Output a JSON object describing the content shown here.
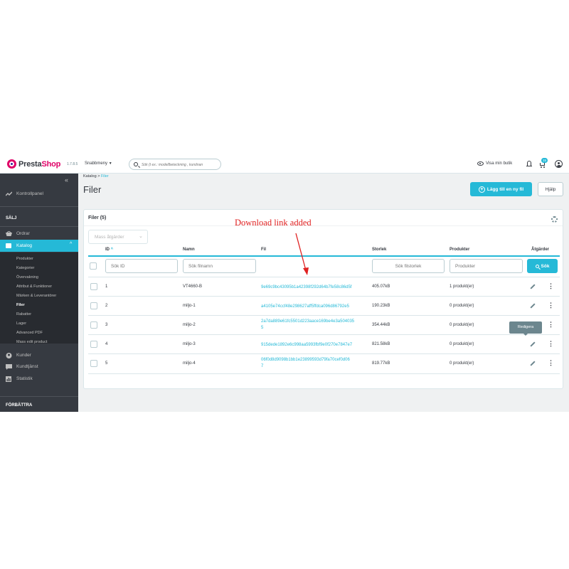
{
  "header": {
    "brand_prefix": "Presta",
    "brand_suffix": "Shop",
    "version": "1.7.8.5",
    "quick_menu_label": "Snabbmeny",
    "search_placeholder": "Sök (t ex.: modellbeteckning , kundnan",
    "view_shop_label": "Visa min butik",
    "cart_badge": "15"
  },
  "sidebar": {
    "dashboard": "Kontrollpanel",
    "section_sell": "SÄLJ",
    "orders": "Ordrar",
    "catalog": "Katalog",
    "catalog_items": [
      "Produkter",
      "Kategorier",
      "Övervakning",
      "Attribut & Funktioner",
      "Märken & Leverantörer",
      "Filer",
      "Rabatter",
      "Lager",
      "Advanced PDF",
      "Mass edit product"
    ],
    "customers": "Kunder",
    "customer_service": "Kundtjänst",
    "stats": "Statistik",
    "section_improve": "FÖRBÄTTRA"
  },
  "breadcrumb": {
    "parent": "Katalog",
    "separator": ">",
    "current": "Filer"
  },
  "page": {
    "title": "Filer",
    "add_button": "Lägg till en ny fil",
    "help_button": "Hjälp"
  },
  "card": {
    "title": "Filer (5)",
    "bulk_actions": "Mass åtgärder",
    "columns": {
      "id": "ID",
      "name": "Namn",
      "file": "Fil",
      "size": "Storlek",
      "products": "Produkter",
      "actions": "Åtgärder"
    },
    "filters": {
      "id": "Sök ID",
      "name": "Sök filnamn",
      "size": "Sök filstorlek",
      "products": "Produkter",
      "search_button": "Sök"
    },
    "rows": [
      {
        "id": "1",
        "name": "VT4660-B",
        "file_line1": "9e69c9bc43095b1a42398f292d64b7fe58c86d5f",
        "file_line2": "",
        "size": "405.07kB",
        "products": "1 produkt(er)"
      },
      {
        "id": "2",
        "name": "miljo-1",
        "file_line1": "a4105e74ccf48e298627aff5ffdca096d86792e5",
        "file_line2": "",
        "size": "190.23kB",
        "products": "0 produkt(er)"
      },
      {
        "id": "3",
        "name": "miljo-2",
        "file_line1": "2a7da889e61fc5501d223aace169be4e3a504035",
        "file_line2": "5",
        "size": "354.44kB",
        "products": "0 produkt(er)"
      },
      {
        "id": "4",
        "name": "miljo-3",
        "file_line1": "915dede1892e6c998aa5993fbf9e0f270e7847e7",
        "file_line2": "",
        "size": "821.58kB",
        "products": "0 produkt(er)"
      },
      {
        "id": "5",
        "name": "miljo-4",
        "file_line1": "06f0d8d9098b1bb1e23899593d79fa70cef0d06",
        "file_line2": "7",
        "size": "819.77kB",
        "products": "0 produkt(er)"
      }
    ],
    "tooltip": "Redigera"
  },
  "annotation": {
    "text": "Download link added",
    "color": "#e02020"
  },
  "colors": {
    "accent": "#25b9d7",
    "sidebar": "#363a41",
    "brand": "#df0067"
  }
}
